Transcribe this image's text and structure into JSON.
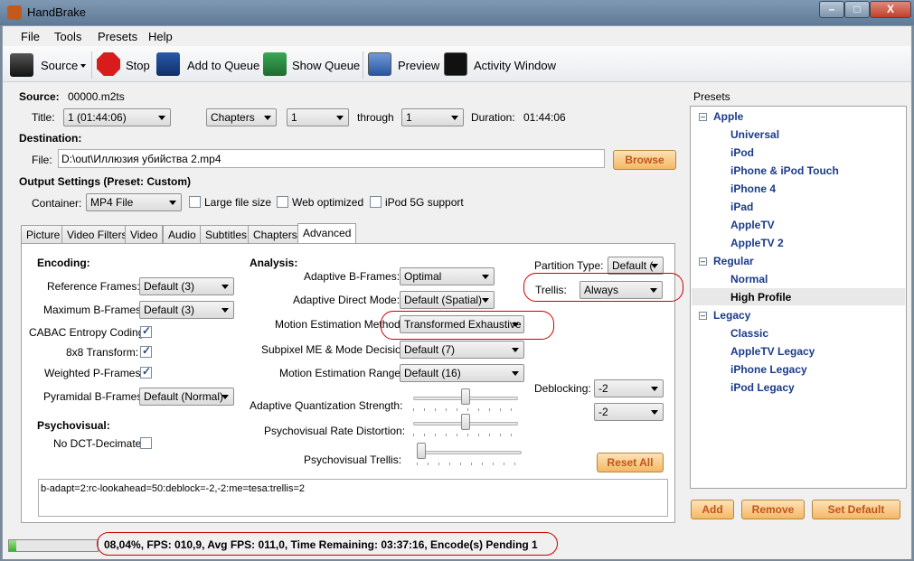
{
  "window": {
    "title": "HandBrake",
    "controls": [
      "–",
      "□",
      "X"
    ]
  },
  "menu": [
    "File",
    "Tools",
    "Presets",
    "Help"
  ],
  "toolbar": {
    "source": "Source",
    "stop": "Stop",
    "add_to_queue": "Add to Queue",
    "show_queue": "Show Queue",
    "preview": "Preview",
    "activity_window": "Activity Window"
  },
  "source": {
    "label": "Source:",
    "value": "00000.m2ts",
    "title_label": "Title:",
    "title_value": "1 (01:44:06)",
    "range_type": "Chapters",
    "range_from": "1",
    "through_label": "through",
    "range_to": "1",
    "duration_label": "Duration:",
    "duration_value": "01:44:06"
  },
  "destination": {
    "label": "Destination:",
    "file_label": "File:",
    "file_value": "D:\\out\\Иллюзия убийства 2.mp4",
    "browse": "Browse"
  },
  "output": {
    "label": "Output Settings (Preset: Custom)",
    "container_label": "Container:",
    "container_value": "MP4 File",
    "large_file": "Large file size",
    "web_optimized": "Web optimized",
    "ipod_5g": "iPod 5G support"
  },
  "tabs": [
    "Picture",
    "Video Filters",
    "Video",
    "Audio",
    "Subtitles",
    "Chapters",
    "Advanced"
  ],
  "encoding": {
    "heading": "Encoding:",
    "ref_frames_label": "Reference Frames:",
    "ref_frames_value": "Default (3)",
    "max_bframes_label": "Maximum B-Frames:",
    "max_bframes_value": "Default (3)",
    "cabac_label": "CABAC Entropy Coding:",
    "transform_label": "8x8 Transform:",
    "weighted_label": "Weighted P-Frames:",
    "pyramidal_label": "Pyramidal B-Frames:",
    "pyramidal_value": "Default (Normal)"
  },
  "psychovisual": {
    "heading": "Psychovisual:",
    "no_dct_label": "No DCT-Decimate:"
  },
  "analysis": {
    "heading": "Analysis:",
    "adaptive_b_label": "Adaptive B-Frames:",
    "adaptive_b_value": "Optimal",
    "adaptive_direct_label": "Adaptive Direct Mode:",
    "adaptive_direct_value": "Default (Spatial)",
    "motion_method_label": "Motion Estimation Method:",
    "motion_method_value": "Transformed Exhaustive",
    "subpixel_label": "Subpixel ME & Mode Decision:",
    "subpixel_value": "Default (7)",
    "motion_range_label": "Motion Estimation Range:",
    "motion_range_value": "Default (16)",
    "aq_label": "Adaptive Quantization Strength:",
    "psy_rd_label": "Psychovisual Rate Distortion:",
    "psy_trellis_label": "Psychovisual Trellis:",
    "partition_label": "Partition Type:",
    "partition_value": "Default (",
    "trellis_label": "Trellis:",
    "trellis_value": "Always",
    "deblocking_label": "Deblocking:",
    "deblock_a": "-2",
    "deblock_b": "-2",
    "reset_all": "Reset All",
    "options_string": "b-adapt=2:rc-lookahead=50:deblock=-2,-2:me=tesa:trellis=2"
  },
  "sliders": {
    "aq": 0.5,
    "psy_rd": 0.5,
    "psy_trellis": 0.0
  },
  "presets": {
    "title": "Presets",
    "groups": [
      {
        "name": "Apple",
        "items": [
          "Universal",
          "iPod",
          "iPhone & iPod Touch",
          "iPhone 4",
          "iPad",
          "AppleTV",
          "AppleTV 2"
        ]
      },
      {
        "name": "Regular",
        "items": [
          "Normal",
          "High Profile"
        ]
      },
      {
        "name": "Legacy",
        "items": [
          "Classic",
          "AppleTV Legacy",
          "iPhone Legacy",
          "iPod Legacy"
        ]
      }
    ],
    "selected": "High Profile",
    "add": "Add",
    "remove": "Remove",
    "set_default": "Set Default"
  },
  "status": {
    "progress": 0.0804,
    "text": "08,04%,  FPS: 010,9,  Avg FPS: 011,0,  Time Remaining: 03:37:16,  Encode(s) Pending 1"
  },
  "colors": {
    "accent": "#1a3a8a",
    "orange_button": "#f4b865",
    "highlight_oval": "#cc0000"
  }
}
